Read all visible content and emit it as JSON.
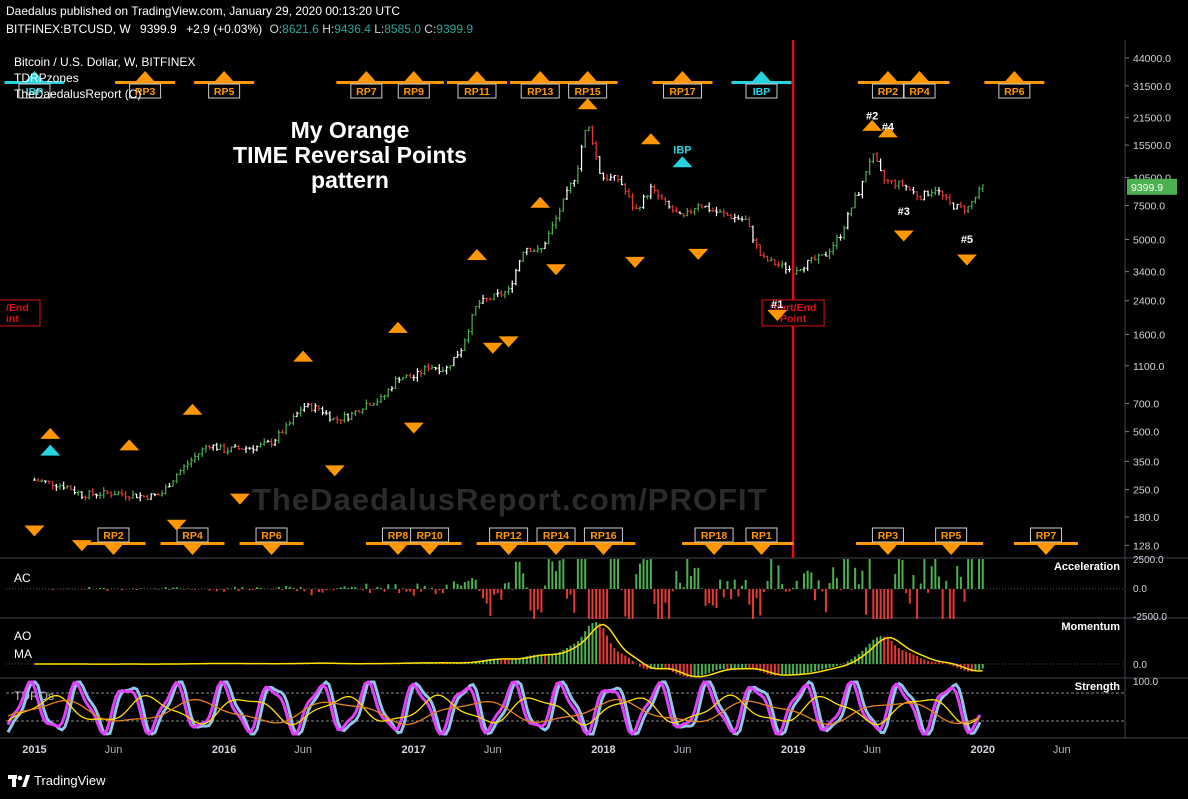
{
  "header": {
    "publisher_line": "Daedalus published on TradingView.com, January 29, 2020 00:13:20 UTC",
    "symbol": "BITFINEX:BTCUSD, W",
    "last": "9399.9",
    "change": "+2.9 (+0.03%)",
    "o_label": "O:",
    "o_val": "8621.6",
    "h_label": "H:",
    "h_val": "9436.4",
    "l_label": "L:",
    "l_val": "8585.0",
    "c_label": "C:",
    "c_val": "9399.9"
  },
  "legend": {
    "title": "Bitcoin / U.S. Dollar, W, BITFINEX",
    "line2": "TDRPzones",
    "line3": "TheDaedalusReport (C)"
  },
  "watermark": "TheDaedalusReport.com/PROFIT",
  "headline": [
    "My Orange",
    "TIME Reversal Points",
    "pattern"
  ],
  "footer": {
    "brand": "TradingView"
  },
  "pane_labels": {
    "ac": "AC",
    "ac_title": "Acceleration",
    "ao": "AO",
    "ma": "MA",
    "ao_title": "Momentum",
    "strength_label": "TDROs",
    "strength_title": "Strength"
  },
  "start_end_label": [
    "Start/End",
    "Point"
  ],
  "start_end_label_left": [
    "/End",
    "int"
  ],
  "colors": {
    "background": "#000000",
    "up": "#4caf50",
    "down": "#e53935",
    "neutral": "#ffffff",
    "orange": "#ff9800",
    "cyan": "#26d4e0",
    "red_line": "#e01010",
    "magenta": "#e040fb",
    "lightblue": "#8ec5e8",
    "yellow": "#ffe000",
    "darkorange": "#e6821e",
    "green_text": "#26a69a"
  },
  "chart_data": [
    {
      "type": "candlestick",
      "title": "Bitcoin / U.S. Dollar, W, BITFINEX",
      "scale": "log",
      "ylim": [
        110,
        52000
      ],
      "y_ticks": [
        "44000.0",
        "31500.0",
        "21500.0",
        "15500.0",
        "10500.0",
        "7500.0",
        "5000.0",
        "3400.0",
        "2400.0",
        "1600.0",
        "1100.0",
        "700.0",
        "500.0",
        "350.0",
        "250.0",
        "180.0",
        "128.0"
      ],
      "x_ticks": [
        "2015",
        "Jun",
        "2016",
        "Jun",
        "2017",
        "Jun",
        "2018",
        "Jun",
        "2019",
        "Jun",
        "2020",
        "Jun"
      ],
      "last_price_label": "9399.9",
      "price_path": [
        [
          "2015-01",
          280
        ],
        [
          "2015-03",
          260
        ],
        [
          "2015-04",
          235
        ],
        [
          "2015-06",
          240
        ],
        [
          "2015-08",
          230
        ],
        [
          "2015-09",
          235
        ],
        [
          "2015-10",
          300
        ],
        [
          "2015-11",
          360
        ],
        [
          "2015-12",
          430
        ],
        [
          "2016-01",
          400
        ],
        [
          "2016-02",
          410
        ],
        [
          "2016-03",
          415
        ],
        [
          "2016-04",
          440
        ],
        [
          "2016-05",
          530
        ],
        [
          "2016-06",
          680
        ],
        [
          "2016-07",
          660
        ],
        [
          "2016-08",
          575
        ],
        [
          "2016-09",
          610
        ],
        [
          "2016-10",
          700
        ],
        [
          "2016-11",
          740
        ],
        [
          "2016-12",
          960
        ],
        [
          "2017-01",
          960
        ],
        [
          "2017-02",
          1100
        ],
        [
          "2017-03",
          1050
        ],
        [
          "2017-04",
          1350
        ],
        [
          "2017-05",
          2300
        ],
        [
          "2017-06",
          2500
        ],
        [
          "2017-07",
          2700
        ],
        [
          "2017-08",
          4600
        ],
        [
          "2017-09",
          4300
        ],
        [
          "2017-10",
          6400
        ],
        [
          "2017-11",
          9900
        ],
        [
          "2017-12",
          14000
        ],
        [
          "2018-01",
          10500
        ],
        [
          "2018-02",
          10300
        ],
        [
          "2018-03",
          7000
        ],
        [
          "2018-04",
          9200
        ],
        [
          "2018-05",
          7500
        ],
        [
          "2018-06",
          6400
        ],
        [
          "2018-07",
          7700
        ],
        [
          "2018-08",
          7000
        ],
        [
          "2018-09",
          6600
        ],
        [
          "2018-10",
          6300
        ],
        [
          "2018-11",
          4000
        ],
        [
          "2018-12",
          3700
        ],
        [
          "2019-01",
          3450
        ],
        [
          "2019-02",
          3800
        ],
        [
          "2019-03",
          4100
        ],
        [
          "2019-04",
          5300
        ],
        [
          "2019-05",
          8500
        ],
        [
          "2019-06",
          10800
        ],
        [
          "2019-07",
          10000
        ],
        [
          "2019-08",
          9600
        ],
        [
          "2019-09",
          8300
        ],
        [
          "2019-10",
          9200
        ],
        [
          "2019-11",
          7500
        ],
        [
          "2019-12",
          7200
        ],
        [
          "2020-01",
          9400
        ]
      ],
      "highs": [
        [
          "2017-12",
          19800
        ],
        [
          "2019-06",
          13800
        ]
      ],
      "start_end_point": "2019-01"
    },
    {
      "type": "histogram",
      "name": "AC",
      "title": "Acceleration",
      "y_ticks": [
        "2500.0",
        "0.0",
        "-2500.0"
      ]
    },
    {
      "type": "histogram+line",
      "name": "AO",
      "title": "Momentum",
      "y_ticks": [
        "0.0"
      ]
    },
    {
      "type": "oscillator",
      "name": "TDROs",
      "title": "Strength",
      "y_ticks": [
        "100.0"
      ]
    }
  ],
  "rp_top": [
    {
      "label": "IBP",
      "t": "2015-01",
      "color": "cyan"
    },
    {
      "label": "RP3",
      "t": "2015-08",
      "color": "orange"
    },
    {
      "label": "RP5",
      "t": "2016-01",
      "color": "orange"
    },
    {
      "label": "RP7",
      "t": "2016-10",
      "color": "orange"
    },
    {
      "label": "RP9",
      "t": "2017-01",
      "color": "orange"
    },
    {
      "label": "RP11",
      "t": "2017-05",
      "color": "orange"
    },
    {
      "label": "RP13",
      "t": "2017-09",
      "color": "orange"
    },
    {
      "label": "RP15",
      "t": "2017-12",
      "color": "orange"
    },
    {
      "label": "RP17",
      "t": "2018-06",
      "color": "orange"
    },
    {
      "label": "IBP",
      "t": "2018-11",
      "color": "cyan"
    },
    {
      "label": "RP2",
      "t": "2019-07",
      "color": "orange"
    },
    {
      "label": "RP4",
      "t": "2019-09",
      "color": "orange"
    },
    {
      "label": "RP6",
      "t": "2020-03",
      "color": "orange"
    }
  ],
  "rp_bottom": [
    {
      "label": "RP2",
      "t": "2015-06"
    },
    {
      "label": "RP4",
      "t": "2015-11"
    },
    {
      "label": "RP6",
      "t": "2016-04"
    },
    {
      "label": "RP8",
      "t": "2016-12"
    },
    {
      "label": "RP10",
      "t": "2017-02"
    },
    {
      "label": "RP12",
      "t": "2017-07"
    },
    {
      "label": "RP14",
      "t": "2017-10"
    },
    {
      "label": "RP16",
      "t": "2018-01"
    },
    {
      "label": "RP18",
      "t": "2018-08"
    },
    {
      "label": "RP1",
      "t": "2018-11"
    },
    {
      "label": "RP3",
      "t": "2019-07"
    },
    {
      "label": "RP5",
      "t": "2019-11"
    },
    {
      "label": "RP7",
      "t": "2020-05"
    }
  ],
  "point_labels": [
    {
      "label": "#1",
      "t": "2018-12"
    },
    {
      "label": "#2",
      "t": "2019-06"
    },
    {
      "label": "#3",
      "t": "2019-08"
    },
    {
      "label": "#4",
      "t": "2019-07"
    },
    {
      "label": "#5",
      "t": "2019-12"
    },
    {
      "label": "IBP",
      "t": "2018-06"
    }
  ]
}
